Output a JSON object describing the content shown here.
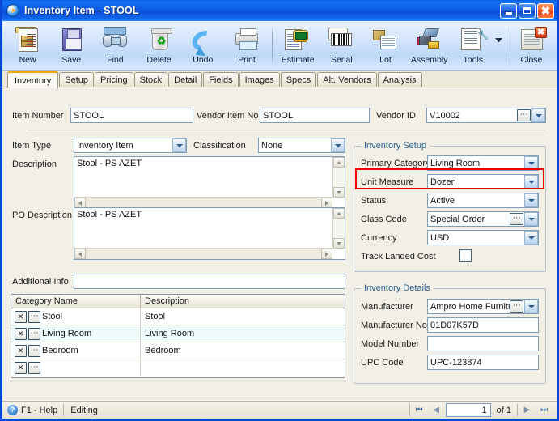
{
  "window": {
    "title_main": "Inventory Item",
    "title_sep": " - ",
    "title_doc": "STOOL",
    "icon": "play-circle-icon",
    "buttons": {
      "minimize": "Minimize",
      "maximize": "Maximize",
      "close": "Close"
    },
    "accent_color": "#0a46d8",
    "highlight_color": "#ee0000"
  },
  "toolbar": {
    "items": [
      {
        "label": "New",
        "icon": "new-item-icon"
      },
      {
        "label": "Save",
        "icon": "floppy-disk-icon"
      },
      {
        "label": "Find",
        "icon": "binoculars-icon"
      },
      {
        "label": "Delete",
        "icon": "recycle-bin-icon"
      },
      {
        "label": "Undo",
        "icon": "undo-arrow-icon"
      },
      {
        "label": "Print",
        "icon": "printer-icon"
      },
      {
        "label": "Estimate",
        "icon": "estimate-tag-icon"
      },
      {
        "label": "Serial",
        "icon": "barcode-icon"
      },
      {
        "label": "Lot",
        "icon": "lot-box-icon"
      },
      {
        "label": "Assembly",
        "icon": "assembly-blocks-icon"
      },
      {
        "label": "Tools",
        "icon": "tools-wrench-icon"
      },
      {
        "label": "Close",
        "icon": "close-document-icon"
      }
    ]
  },
  "tabs": [
    {
      "label": "Inventory",
      "active": true
    },
    {
      "label": "Setup",
      "active": false
    },
    {
      "label": "Pricing",
      "active": false
    },
    {
      "label": "Stock",
      "active": false
    },
    {
      "label": "Detail",
      "active": false
    },
    {
      "label": "Fields",
      "active": false
    },
    {
      "label": "Images",
      "active": false
    },
    {
      "label": "Specs",
      "active": false
    },
    {
      "label": "Alt. Vendors",
      "active": false
    },
    {
      "label": "Analysis",
      "active": false
    }
  ],
  "form": {
    "item_number": {
      "label": "Item Number",
      "value": "STOOL"
    },
    "vendor_item_no": {
      "label": "Vendor Item No",
      "value": "STOOL"
    },
    "vendor_id": {
      "label": "Vendor ID",
      "value": "V10002"
    },
    "item_type": {
      "label": "Item Type",
      "value": "Inventory Item"
    },
    "classification": {
      "label": "Classification",
      "value": "None"
    },
    "description": {
      "label": "Description",
      "value": "Stool - PS AZET"
    },
    "po_description": {
      "label": "PO Description",
      "value": "Stool - PS AZET"
    },
    "additional_info": {
      "label": "Additional Info",
      "value": ""
    }
  },
  "inventory_setup": {
    "title": "Inventory Setup",
    "fields": [
      {
        "label": "Primary Category",
        "value": "Living Room",
        "has_ellipsis": false,
        "highlighted": false
      },
      {
        "label": "Unit Measure",
        "value": "Dozen",
        "has_ellipsis": false,
        "highlighted": true
      },
      {
        "label": "Status",
        "value": "Active",
        "has_ellipsis": false,
        "highlighted": false
      },
      {
        "label": "Class Code",
        "value": "Special Order",
        "has_ellipsis": true,
        "highlighted": false
      },
      {
        "label": "Currency",
        "value": "USD",
        "has_ellipsis": false,
        "highlighted": false
      }
    ],
    "track_landed_cost": {
      "label": "Track Landed Cost",
      "checked": false
    }
  },
  "inventory_details": {
    "title": "Inventory Details",
    "manufacturer": {
      "label": "Manufacturer",
      "value": "Ampro Home Furniture"
    },
    "manufacturer_no": {
      "label": "Manufacturer No",
      "value": "01D07K57D"
    },
    "model_number": {
      "label": "Model Number",
      "value": ""
    },
    "upc_code": {
      "label": "UPC Code",
      "value": "UPC-123874"
    }
  },
  "category_grid": {
    "columns": [
      "Category Name",
      "Description"
    ],
    "rows": [
      {
        "name": "Stool",
        "description": "Stool"
      },
      {
        "name": "Living Room",
        "description": "Living Room"
      },
      {
        "name": "Bedroom",
        "description": "Bedroom"
      },
      {
        "name": "",
        "description": ""
      }
    ],
    "row_buttons": {
      "delete": "X",
      "lookup": "..."
    }
  },
  "statusbar": {
    "help": "F1 - Help",
    "help_icon": "question-circle-icon",
    "status": "Editing",
    "nav": {
      "first": "first-record-icon",
      "prev": "previous-record-icon",
      "page": "1",
      "of_label": "of",
      "total": "1",
      "next": "next-record-icon",
      "last": "last-record-icon"
    }
  }
}
